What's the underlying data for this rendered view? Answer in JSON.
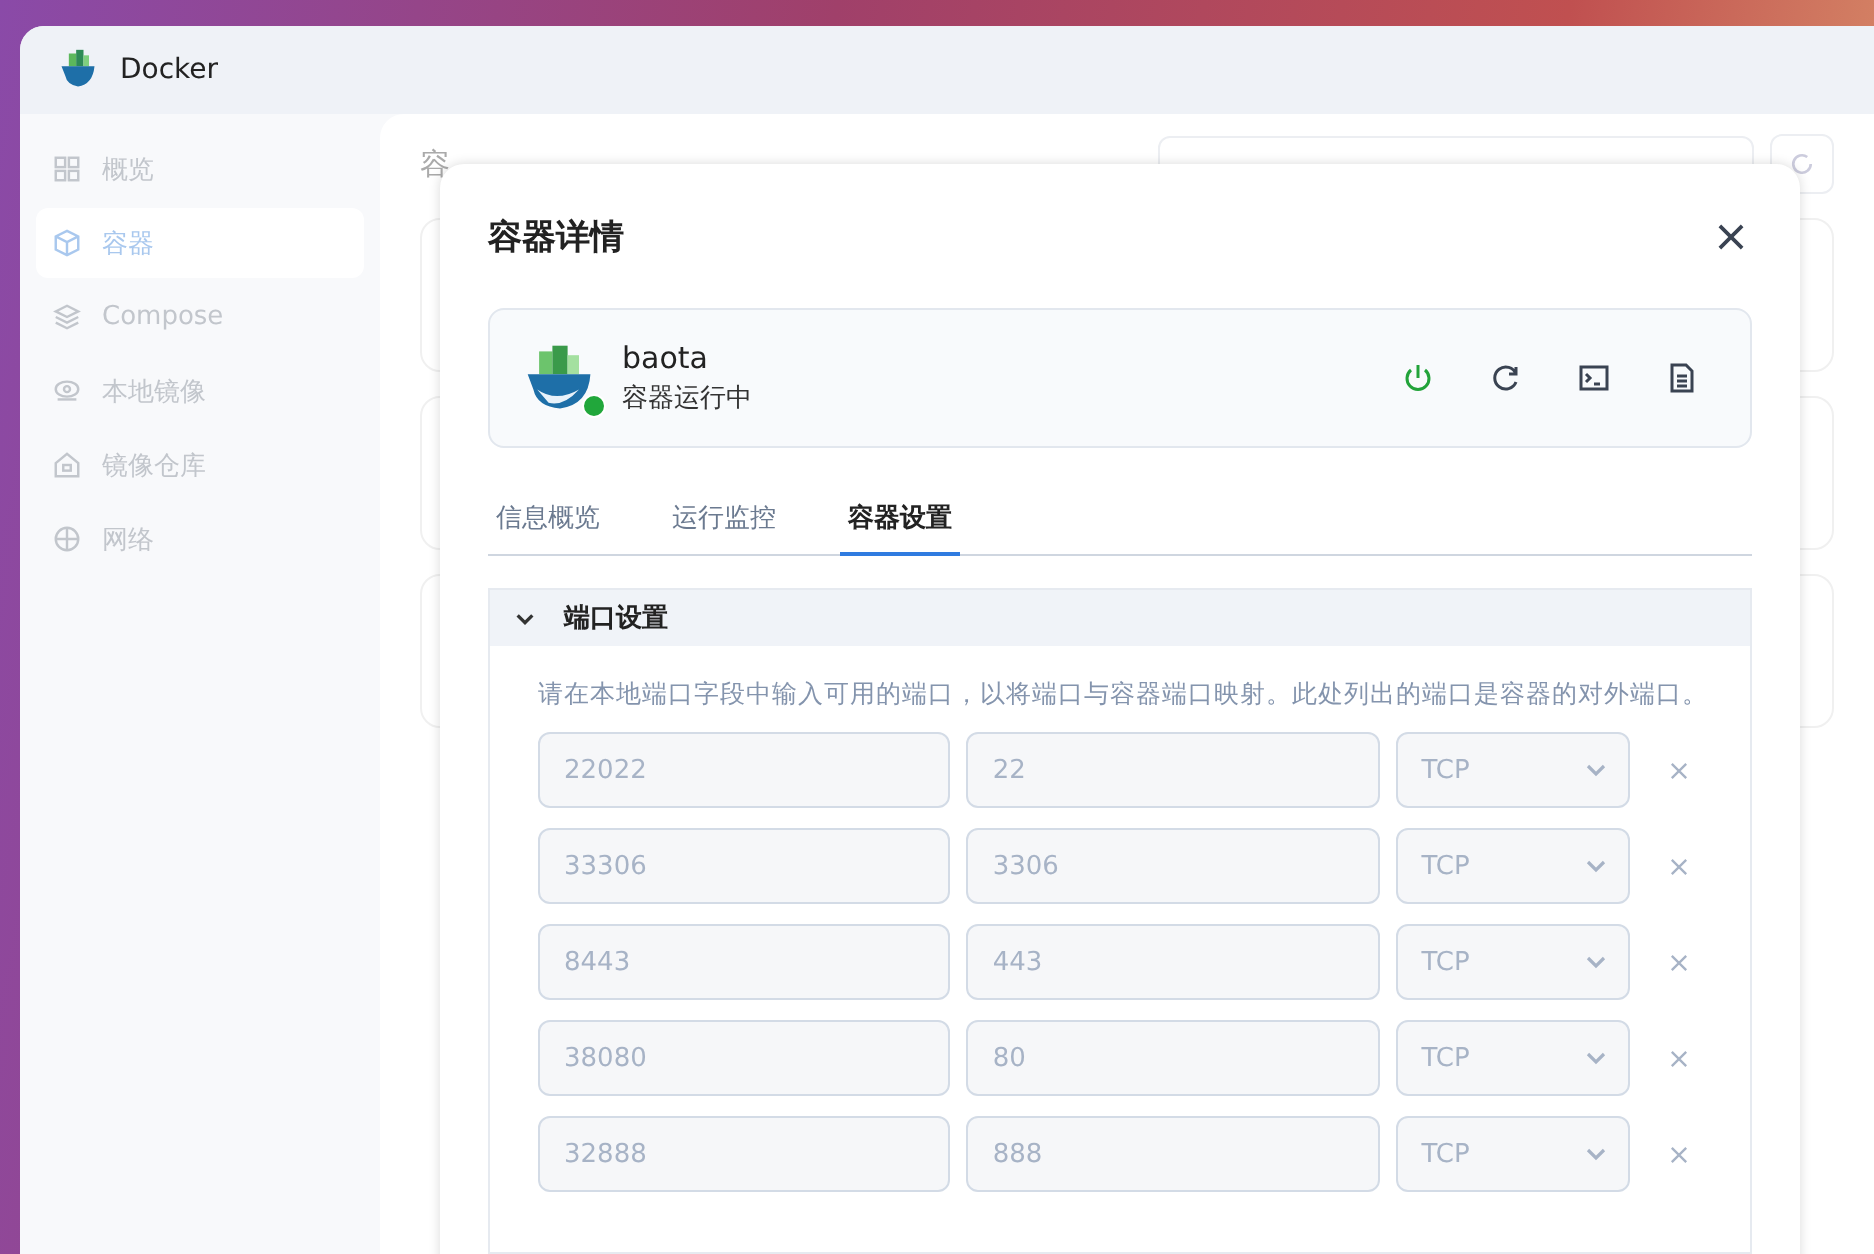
{
  "app": {
    "title": "Docker"
  },
  "sidebar": {
    "items": [
      {
        "label": "概览",
        "selected": false
      },
      {
        "label": "容器",
        "selected": true
      },
      {
        "label": "Compose",
        "selected": false
      },
      {
        "label": "本地镜像",
        "selected": false
      },
      {
        "label": "镜像仓库",
        "selected": false
      },
      {
        "label": "网络",
        "selected": false
      }
    ]
  },
  "main": {
    "title": "容"
  },
  "dialog": {
    "title": "容器详情",
    "container": {
      "name": "baota",
      "status": "容器运行中",
      "running": true
    },
    "tabs": [
      {
        "label": "信息概览",
        "selected": false
      },
      {
        "label": "运行监控",
        "selected": false
      },
      {
        "label": "容器设置",
        "selected": true
      }
    ],
    "section": {
      "title": "端口设置",
      "expanded": true,
      "hint": "请在本地端口字段中输入可用的端口，以将端口与容器端口映射。此处列出的端口是容器的对外端口。",
      "ports": [
        {
          "local": "22022",
          "container": "22",
          "protocol": "TCP"
        },
        {
          "local": "33306",
          "container": "3306",
          "protocol": "TCP"
        },
        {
          "local": "8443",
          "container": "443",
          "protocol": "TCP"
        },
        {
          "local": "38080",
          "container": "80",
          "protocol": "TCP"
        },
        {
          "local": "32888",
          "container": "888",
          "protocol": "TCP"
        }
      ]
    }
  }
}
